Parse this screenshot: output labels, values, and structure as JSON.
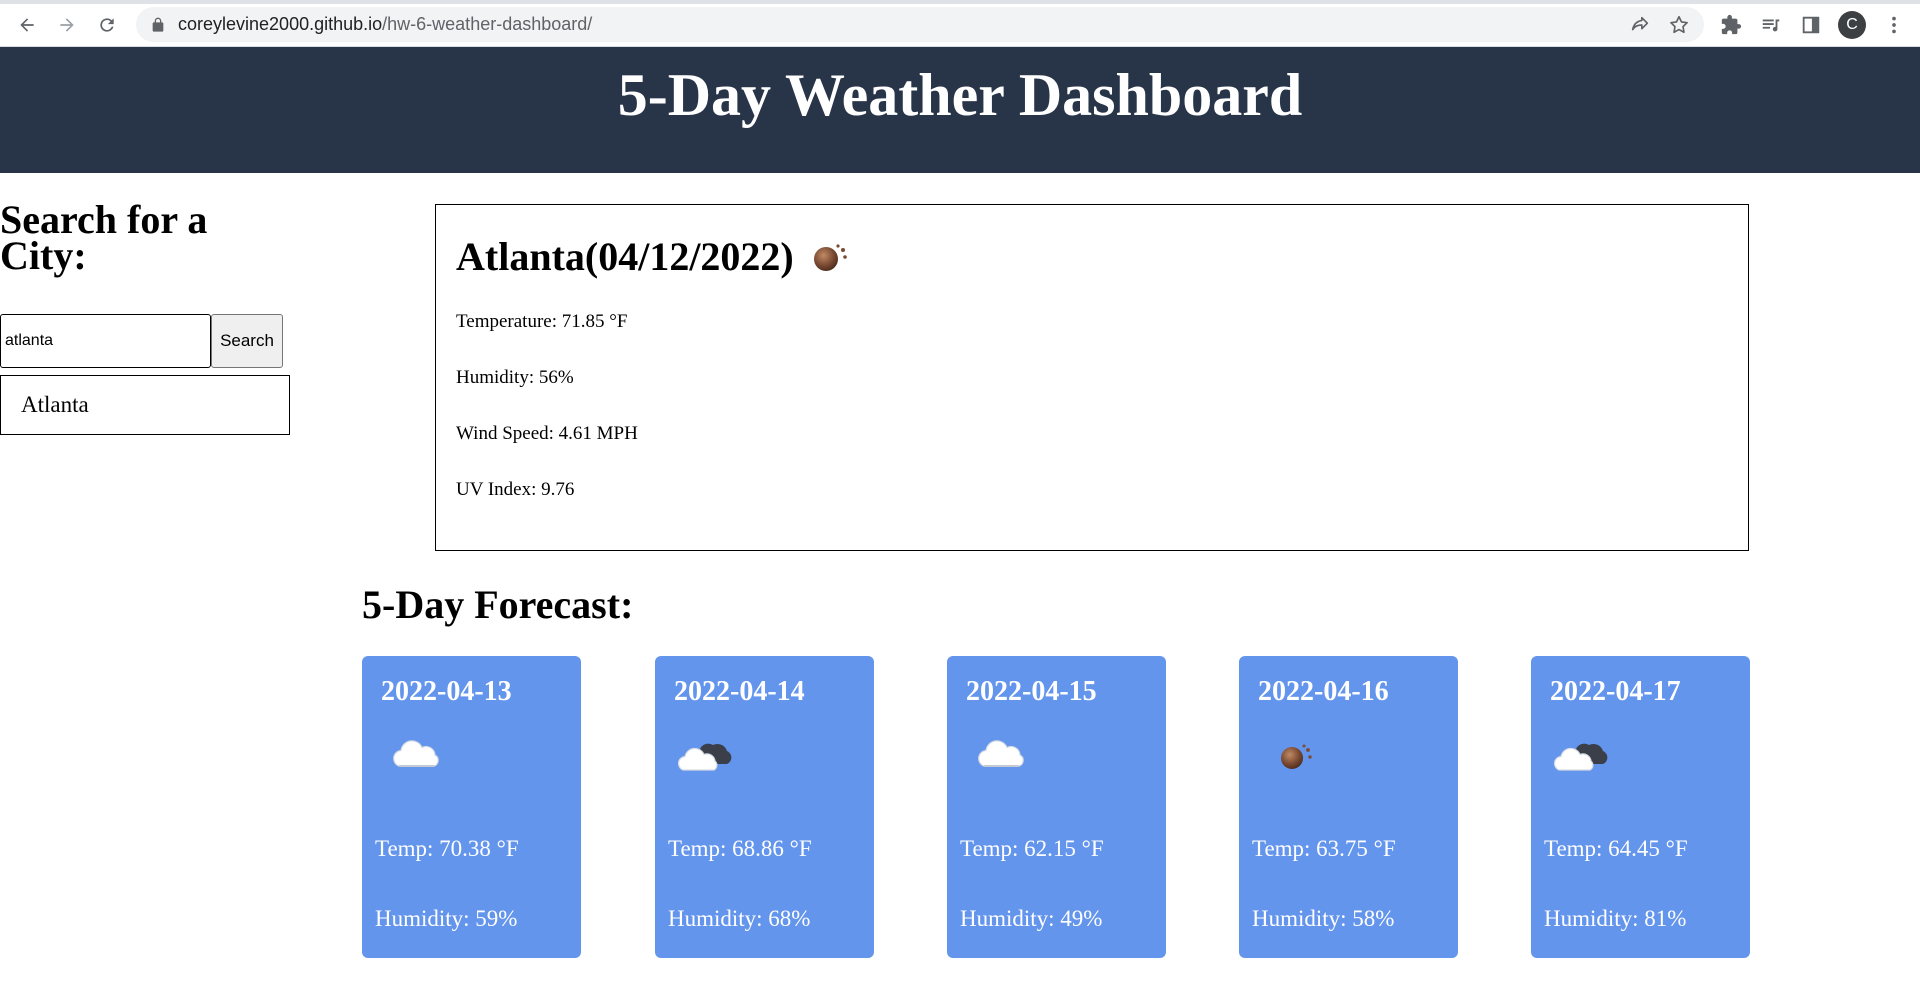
{
  "browser": {
    "url_domain": "coreylevine2000.github.io",
    "url_path": "/hw-6-weather-dashboard/",
    "profile_initial": "C"
  },
  "header": {
    "title": "5-Day Weather Dashboard"
  },
  "search": {
    "title": "Search for a City:",
    "input_value": "atlanta",
    "button_label": "Search",
    "history": [
      "Atlanta"
    ]
  },
  "current": {
    "heading": "Atlanta(04/12/2022)",
    "icon": "sun-dark-icon",
    "temperature": "Temperature: 71.85 °F",
    "humidity": "Humidity: 56%",
    "wind": "Wind Speed: 4.61 MPH",
    "uv": "UV Index: 9.76"
  },
  "forecast": {
    "title": "5-Day Forecast:",
    "card_color": "#6495ed",
    "days": [
      {
        "date": "2022-04-13",
        "icon": "cloud-icon",
        "temp": "Temp: 70.38 °F",
        "humidity": "Humidity: 59%"
      },
      {
        "date": "2022-04-14",
        "icon": "partly-cloudy-night-icon",
        "temp": "Temp: 68.86 °F",
        "humidity": "Humidity: 68%"
      },
      {
        "date": "2022-04-15",
        "icon": "cloud-icon",
        "temp": "Temp: 62.15 °F",
        "humidity": "Humidity: 49%"
      },
      {
        "date": "2022-04-16",
        "icon": "sun-dark-icon",
        "temp": "Temp: 63.75 °F",
        "humidity": "Humidity: 58%"
      },
      {
        "date": "2022-04-17",
        "icon": "partly-cloudy-night-icon",
        "temp": "Temp: 64.45 °F",
        "humidity": "Humidity: 81%"
      }
    ]
  },
  "colors": {
    "header_bg": "#283548",
    "card_bg": "#6495ed"
  }
}
